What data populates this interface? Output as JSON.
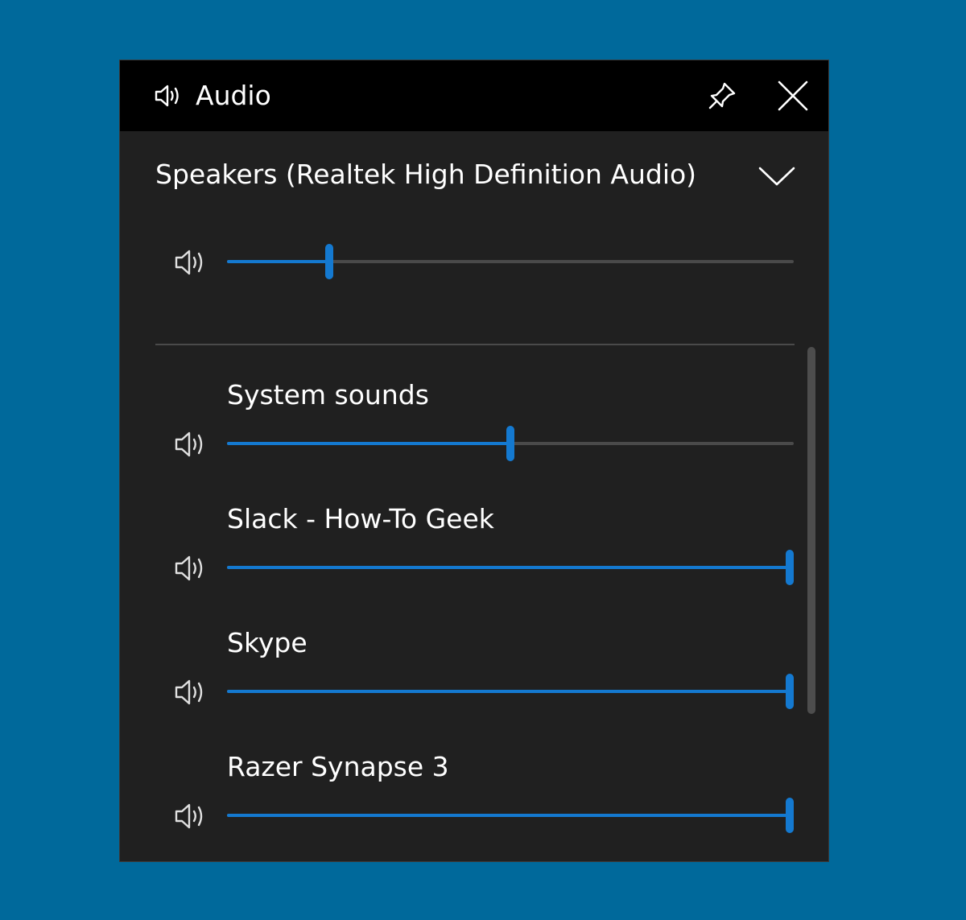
{
  "window": {
    "title": "Audio",
    "title_icon": "speaker-icon",
    "pin_icon": "pin-icon",
    "close_icon": "close-icon"
  },
  "output_device": {
    "label": "Speakers (Realtek High Definition Audio)",
    "dropdown_icon": "chevron-down-icon",
    "volume_percent": 18
  },
  "apps": [
    {
      "name": "System sounds",
      "volume_percent": 50
    },
    {
      "name": "Slack - How-To Geek",
      "volume_percent": 100
    },
    {
      "name": "Skype",
      "volume_percent": 100
    },
    {
      "name": "Razer Synapse 3",
      "volume_percent": 100
    }
  ],
  "colors": {
    "accent": "#1479d0",
    "panel_bg": "#202020",
    "titlebar_bg": "#000000",
    "desktop_bg": "#00699b",
    "track": "#4a4a4a"
  }
}
